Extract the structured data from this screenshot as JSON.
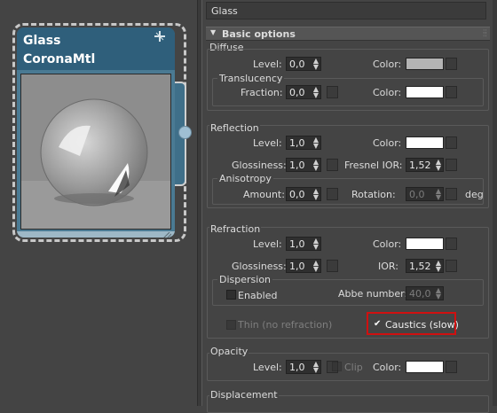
{
  "node": {
    "title_line1": "Glass",
    "title_line2": "CoronaMtl",
    "pin_icon": "pin-icon",
    "resize_icon": "resize-grip-icon"
  },
  "panel": {
    "material_name": "Glass",
    "rollout_title": "Basic options",
    "rollout_icon": "collapse-triangle-icon",
    "diffuse": {
      "title": "Diffuse",
      "level_label": "Level:",
      "level_value": "0,0",
      "color_label": "Color:",
      "color_hex": "#b4b4b4",
      "translucency": {
        "title": "Translucency",
        "fraction_label": "Fraction:",
        "fraction_value": "0,0",
        "color_label": "Color:",
        "color_hex": "#ffffff"
      }
    },
    "reflection": {
      "title": "Reflection",
      "level_label": "Level:",
      "level_value": "1,0",
      "color_label": "Color:",
      "color_hex": "#ffffff",
      "glossiness_label": "Glossiness:",
      "glossiness_value": "1,0",
      "fresnel_label": "Fresnel IOR:",
      "fresnel_value": "1,52",
      "anisotropy": {
        "title": "Anisotropy",
        "amount_label": "Amount:",
        "amount_value": "0,0",
        "rotation_label": "Rotation:",
        "rotation_value": "0,0",
        "rotation_unit": "deg"
      }
    },
    "refraction": {
      "title": "Refraction",
      "level_label": "Level:",
      "level_value": "1,0",
      "color_label": "Color:",
      "color_hex": "#ffffff",
      "glossiness_label": "Glossiness:",
      "glossiness_value": "1,0",
      "ior_label": "IOR:",
      "ior_value": "1,52",
      "dispersion": {
        "title": "Dispersion",
        "enabled_label": "Enabled",
        "enabled_checked": false,
        "abbe_label": "Abbe number:",
        "abbe_value": "40,0"
      },
      "thin_label": "Thin (no refraction)",
      "thin_checked": false,
      "caustics_label": "Caustics (slow)",
      "caustics_checked": true,
      "caustics_check_glyph": "✔"
    },
    "opacity": {
      "title": "Opacity",
      "level_label": "Level:",
      "level_value": "1,0",
      "clip_label": "Clip",
      "color_label": "Color:",
      "color_hex": "#ffffff"
    },
    "displacement": {
      "title": "Displacement"
    }
  }
}
